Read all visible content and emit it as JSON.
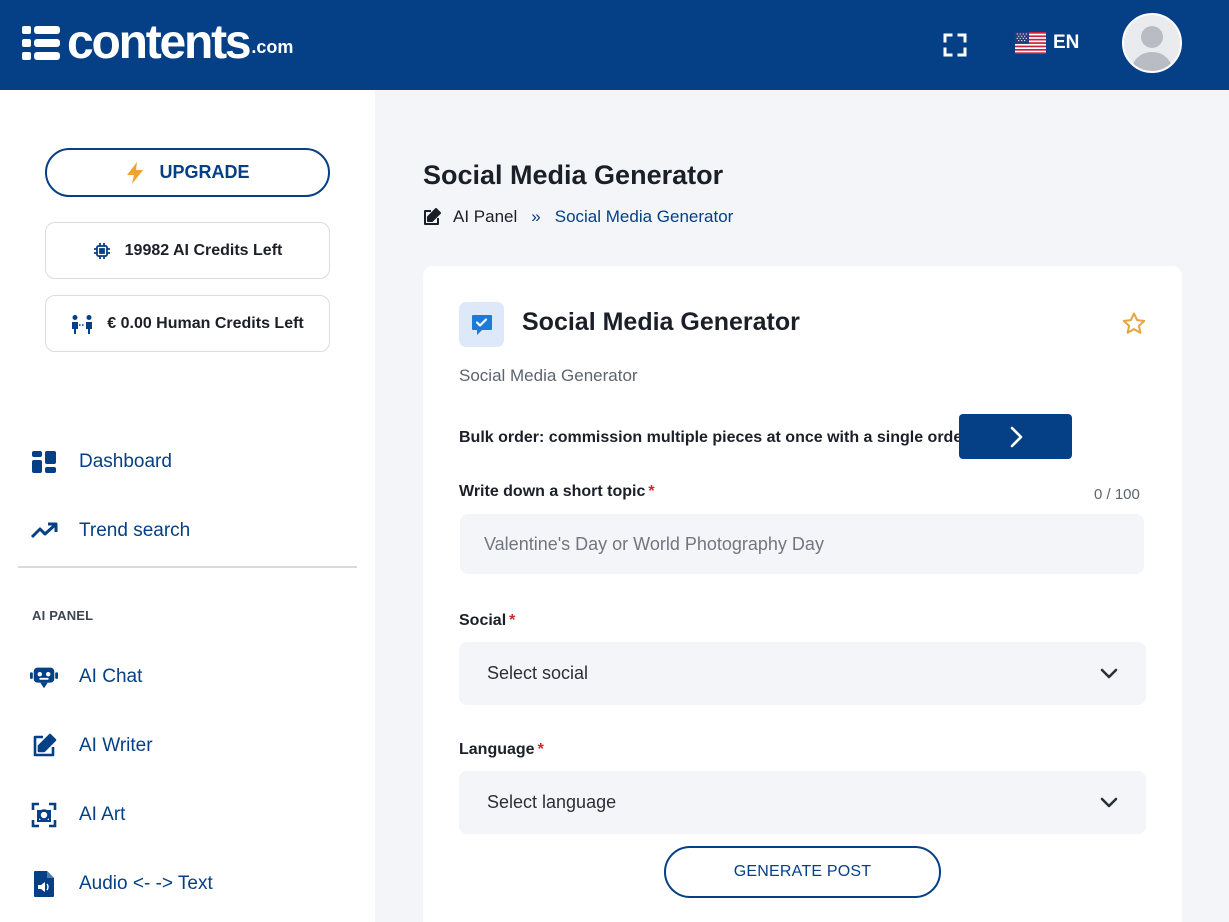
{
  "header": {
    "logo_text": "contents",
    "logo_suffix": ".com",
    "language": "EN",
    "icons": [
      "fullscreen-icon",
      "us-flag-icon",
      "user-avatar-icon"
    ]
  },
  "sidebar": {
    "upgrade_label": "UPGRADE",
    "ai_credits": "19982 AI Credits Left",
    "human_credits": "€ 0.00 Human Credits Left",
    "nav_top": [
      {
        "label": "Dashboard",
        "icon": "dashboard-icon"
      },
      {
        "label": "Trend search",
        "icon": "trend-icon"
      }
    ],
    "section_label": "AI PANEL",
    "nav_ai": [
      {
        "label": "AI Chat",
        "icon": "robot-icon"
      },
      {
        "label": "AI Writer",
        "icon": "edit-icon"
      },
      {
        "label": "AI Art",
        "icon": "camera-icon"
      },
      {
        "label": "Audio <- -> Text",
        "icon": "audio-file-icon"
      }
    ]
  },
  "main": {
    "page_title": "Social Media Generator",
    "breadcrumb": {
      "home": "AI Panel",
      "separator": "»",
      "current": "Social Media Generator"
    },
    "card": {
      "title": "Social Media Generator",
      "subtitle": "Social Media Generator",
      "bulk_text": "Bulk order: commission multiple pieces at once with a single order.",
      "topic": {
        "label": "Write down a short topic",
        "required": "*",
        "counter": "0 / 100",
        "value": "",
        "placeholder": "Valentine's Day or World Photography Day"
      },
      "social": {
        "label": "Social",
        "required": "*",
        "value": "Select social"
      },
      "language": {
        "label": "Language",
        "required": "*",
        "value": "Select language"
      },
      "generate_label": "GENERATE POST"
    }
  },
  "colors": {
    "brand": "#053f85",
    "background": "#f3f5f8",
    "required": "#d0262c",
    "star": "#e8a33a"
  }
}
